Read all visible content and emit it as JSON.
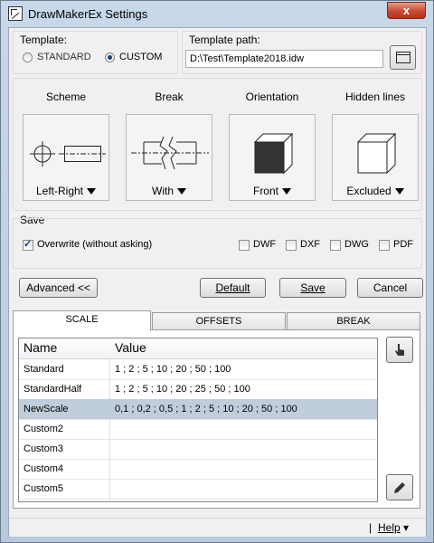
{
  "window": {
    "title": "DrawMakerEx Settings",
    "close_glyph": "x"
  },
  "template": {
    "label": "Template:",
    "options": [
      "STANDARD",
      "CUSTOM"
    ],
    "selected": "CUSTOM",
    "path_label": "Template path:",
    "path_value": "D:\\Test\\Template2018.idw"
  },
  "tiles": [
    {
      "header": "Scheme",
      "value": "Left-Right",
      "icon": "scheme-icon"
    },
    {
      "header": "Break",
      "value": "With",
      "icon": "break-icon"
    },
    {
      "header": "Orientation",
      "value": "Front",
      "icon": "cube-front-icon"
    },
    {
      "header": "Hidden lines",
      "value": "Excluded",
      "icon": "cube-icon"
    }
  ],
  "save": {
    "label": "Save",
    "overwrite": {
      "label": "Overwrite (without asking)",
      "checked": true
    },
    "formats": [
      {
        "label": "DWF",
        "checked": false
      },
      {
        "label": "DXF",
        "checked": false
      },
      {
        "label": "DWG",
        "checked": false
      },
      {
        "label": "PDF",
        "checked": false
      }
    ]
  },
  "buttons": {
    "advanced": "Advanced <<",
    "default": "Default",
    "save": "Save",
    "cancel": "Cancel"
  },
  "tabs": [
    "SCALE",
    "OFFSETS",
    "BREAK"
  ],
  "active_tab": "SCALE",
  "grid": {
    "columns": [
      "Name",
      "Value"
    ],
    "rows": [
      {
        "name": "Standard",
        "value": "1 ; 2 ; 5 ; 10 ; 20 ; 50 ; 100"
      },
      {
        "name": "StandardHalf",
        "value": "1 ; 2 ; 5 ; 10 ; 20 ; 25 ; 50 ; 100"
      },
      {
        "name": "NewScale",
        "value": "0,1 ; 0,2 ; 0,5 ; 1 ; 2 ; 5 ; 10 ; 20 ; 50 ; 100"
      },
      {
        "name": "Custom2",
        "value": ""
      },
      {
        "name": "Custom3",
        "value": ""
      },
      {
        "name": "Custom4",
        "value": ""
      },
      {
        "name": "Custom5",
        "value": ""
      }
    ],
    "selected_row": "NewScale"
  },
  "status": {
    "separator": "|",
    "help": "Help",
    "help_arrow": "▾"
  }
}
